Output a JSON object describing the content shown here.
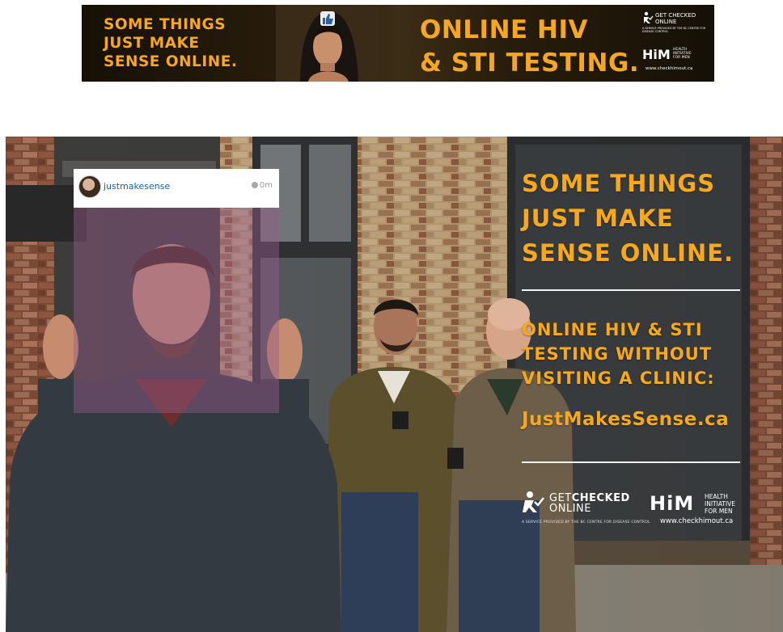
{
  "banner": {
    "headline": [
      "SOME THINGS",
      "JUST MAKE",
      "SENSE ONLINE."
    ],
    "offer": [
      "ONLINE HIV",
      "& STI TESTING."
    ],
    "gco_logo": [
      "GET CHECKED",
      "ONLINE"
    ],
    "gco_tagline": "A SERVICE PROVIDED BY THE BC CENTRE FOR DISEASE CONTROL",
    "him_logo": "HiM",
    "him_tagline": [
      "HEALTH",
      "INITIATIVE",
      "FOR MEN"
    ],
    "him_url": "www.checkhimout.ca"
  },
  "poster": {
    "insta": {
      "username": "justmakesense",
      "time": "0m"
    },
    "headline": [
      "SOME THINGS",
      "JUST MAKE",
      "SENSE ONLINE."
    ],
    "subhead": [
      "ONLINE HIV & STI",
      "TESTING WITHOUT",
      "VISITING A CLINIC:"
    ],
    "url": "JustMakesSense.ca",
    "gco_logo": {
      "part1": "GET",
      "part2": "CHECKED",
      "part3": "ONLINE"
    },
    "gco_tagline": "A SERVICE PROVIDED BY THE BC CENTRE FOR DISEASE CONTROL",
    "him_logo": "HiM",
    "him_tagline": [
      "HEALTH",
      "INITIATIVE",
      "FOR MEN"
    ],
    "him_url": "www.checkhimout.ca"
  },
  "colors": {
    "brand_orange": "#f7a81b",
    "white": "#ffffff",
    "insta_user_blue": "#1f5f9c"
  },
  "icons": [
    "thumbs-up-icon",
    "person-checkmark-icon",
    "avatar"
  ]
}
